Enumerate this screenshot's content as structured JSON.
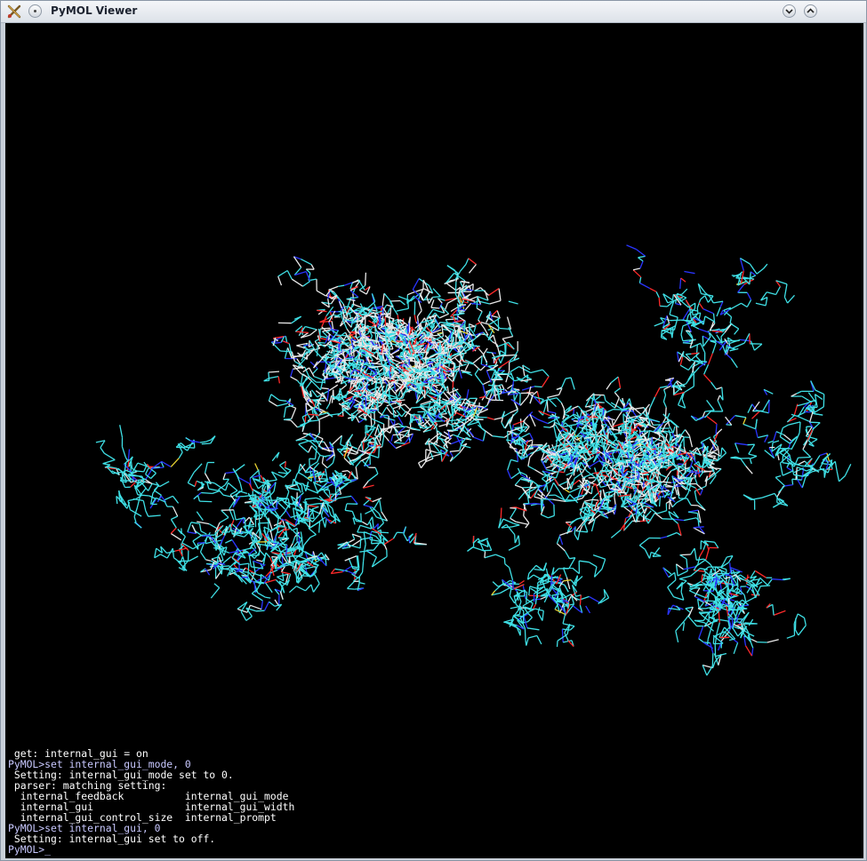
{
  "window": {
    "title": "PyMOL Viewer"
  },
  "icons": {
    "app": "pymol-app-icon",
    "menu": "window-menu-icon",
    "minimize": "chevron-down-icon",
    "maximize": "chevron-up-icon"
  },
  "colors": {
    "carbon": "#3fe0e6",
    "nitrogen": "#2a35ff",
    "oxygen": "#ff2a2a",
    "hydrogen": "#e8e8e8",
    "sulfur": "#e8d232",
    "background": "#000000"
  },
  "console": {
    "lines": [
      {
        "text": " get: internal_gui = on",
        "kind": "output"
      },
      {
        "text": "PyMOL>set internal_gui_mode, 0",
        "kind": "prompt"
      },
      {
        "text": " Setting: internal_gui_mode set to 0.",
        "kind": "output"
      },
      {
        "text": " parser: matching setting:",
        "kind": "output"
      },
      {
        "text": "  internal_feedback          internal_gui_mode",
        "kind": "output"
      },
      {
        "text": "  internal_gui               internal_gui_width",
        "kind": "output"
      },
      {
        "text": "  internal_gui_control_size  internal_prompt",
        "kind": "output"
      },
      {
        "text": "PyMOL>set internal_gui, 0",
        "kind": "prompt"
      },
      {
        "text": " Setting: internal_gui set to off.",
        "kind": "output"
      },
      {
        "text": "PyMOL>_",
        "kind": "prompt"
      }
    ]
  }
}
